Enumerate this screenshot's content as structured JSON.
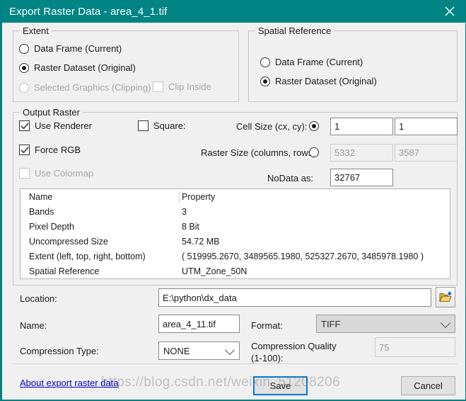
{
  "window": {
    "title": "Export Raster Data - area_4_1.tif",
    "close_icon": "close-icon",
    "accent_color": "#008584"
  },
  "extent": {
    "legend": "Extent",
    "options": [
      {
        "label": "Data Frame (Current)",
        "checked": false,
        "disabled": false
      },
      {
        "label": "Raster Dataset (Original)",
        "checked": true,
        "disabled": false
      },
      {
        "label": "Selected Graphics (Clipping)",
        "checked": false,
        "disabled": true
      }
    ],
    "clip_inside": {
      "label": "Clip Inside",
      "checked": false,
      "disabled": true
    }
  },
  "spatial_reference": {
    "legend": "Spatial Reference",
    "options": [
      {
        "label": "Data Frame (Current)",
        "checked": false,
        "disabled": false
      },
      {
        "label": "Raster Dataset (Original)",
        "checked": true,
        "disabled": false
      }
    ]
  },
  "output_raster": {
    "legend": "Output Raster",
    "use_renderer": {
      "label": "Use Renderer",
      "checked": true,
      "disabled": false
    },
    "force_rgb": {
      "label": "Force RGB",
      "checked": true,
      "disabled": false
    },
    "use_colormap": {
      "label": "Use Colormap",
      "checked": false,
      "disabled": true
    },
    "square": {
      "label": "Square:",
      "checked": false,
      "disabled": false
    },
    "cell_size": {
      "label": "Cell Size (cx, cy):",
      "selected": true,
      "cx": "1",
      "cy": "1"
    },
    "raster_size": {
      "label": "Raster Size (columns, rows):",
      "selected": false,
      "columns": "5332",
      "rows": "3587"
    },
    "nodata": {
      "label": "NoData as:",
      "value": "32767"
    },
    "properties": {
      "headers": [
        "Name",
        "Property"
      ],
      "rows": [
        [
          "Bands",
          "3"
        ],
        [
          "Pixel Depth",
          "8 Bit"
        ],
        [
          "Uncompressed Size",
          "54.72 MB"
        ],
        [
          "Extent (left, top, right, bottom)",
          "( 519995.2670, 3489565.1980, 525327.2670, 3485978.1980 )"
        ],
        [
          "Spatial Reference",
          "UTM_Zone_50N"
        ]
      ]
    }
  },
  "output_settings": {
    "location_label": "Location:",
    "location_value": "E:\\python\\dx_data",
    "browse_icon": "folder-open-icon",
    "name_label": "Name:",
    "name_value": "area_4_11.tif",
    "format_label": "Format:",
    "format_value": "TIFF",
    "compression_type_label": "Compression Type:",
    "compression_type_value": "NONE",
    "compression_quality_label": "Compression Quality (1-100):",
    "compression_quality_label_line1": "Compression Quality",
    "compression_quality_label_line2": "(1-100):",
    "compression_quality_value": "75"
  },
  "footer": {
    "help_link": "About export raster data",
    "save_label": "Save",
    "cancel_label": "Cancel"
  },
  "watermark": "https://blog.csdn.net/weixin_51208206"
}
